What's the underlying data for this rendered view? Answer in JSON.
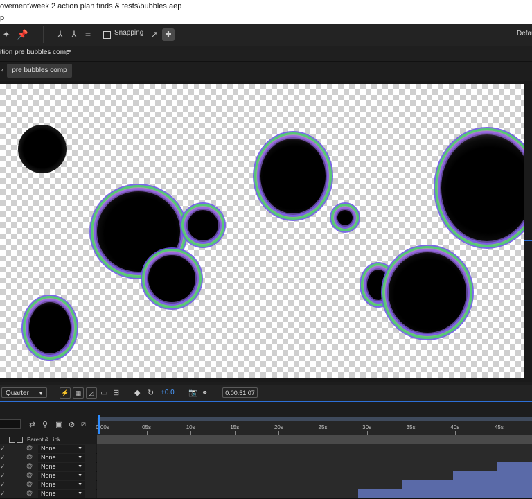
{
  "window": {
    "title": "ovement\\week 2 action plan finds & tests\\bubbles.aep",
    "menu_fragment": "p"
  },
  "toolbar": {
    "snapping_label": "Snapping",
    "workspace_label": "Defau"
  },
  "comp_panel": {
    "tab_label": "ition pre bubbles comp",
    "tab_menu_icon": "≡",
    "breadcrumb_back": "‹",
    "breadcrumb_label": "pre bubbles comp"
  },
  "viewer_controls": {
    "resolution": "Quarter",
    "exposure": "+0.0",
    "timecode": "0:00:51:07"
  },
  "timeline": {
    "parent_link_header": "Parent & Link",
    "ruler_labels": [
      "0:00s",
      "05s",
      "10s",
      "15s",
      "20s",
      "25s",
      "30s",
      "35s",
      "40s",
      "45s"
    ],
    "layers": [
      {
        "parent": "None",
        "bar_start": 0.0,
        "bar_end": 0.0
      },
      {
        "parent": "None",
        "bar_start": 0.0,
        "bar_end": 0.0
      },
      {
        "parent": "None",
        "bar_start": 0.92,
        "bar_end": 1.0
      },
      {
        "parent": "None",
        "bar_start": 0.818,
        "bar_end": 1.0
      },
      {
        "parent": "None",
        "bar_start": 0.7,
        "bar_end": 1.0
      },
      {
        "parent": "None",
        "bar_start": 0.6,
        "bar_end": 1.0
      }
    ]
  },
  "colors": {
    "accent": "#2d8cff",
    "layer_bar": "#5a6aa8"
  }
}
